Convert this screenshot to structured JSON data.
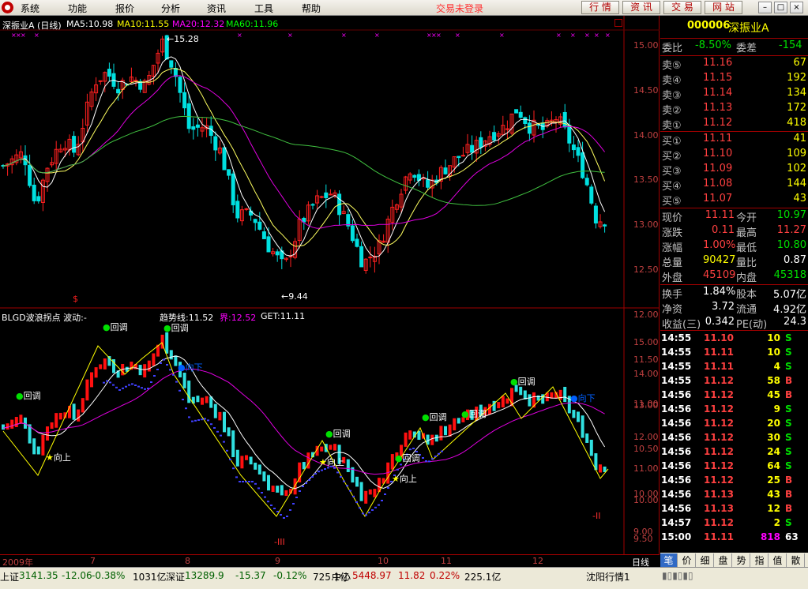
{
  "menu": {
    "items": [
      "系统",
      "功能",
      "报价",
      "分析",
      "资讯",
      "工具",
      "帮助"
    ],
    "status": "交易未登录",
    "buttons": [
      "行 情",
      "资 讯",
      "交 易",
      "网 站"
    ],
    "window_buttons": [
      "–",
      "□",
      "×"
    ]
  },
  "chart": {
    "title": "深振业A (日线)",
    "ma": [
      {
        "label": "MA5:10.98",
        "color": "#ffffff"
      },
      {
        "label": "MA10:11.55",
        "color": "#ffff00"
      },
      {
        "label": "MA20:12.32",
        "color": "#ff00ff"
      },
      {
        "label": "MA60:11.96",
        "color": "#00ff00"
      }
    ],
    "max_label": "15.28",
    "min_label": "9.44",
    "y_ticks_top": [
      "15.00",
      "14.50",
      "14.00",
      "13.50",
      "13.00",
      "12.50",
      "12.00",
      "11.50",
      "11.00",
      "10.50",
      "10.00",
      "9.50"
    ],
    "ind_title": "BLGD波浪拐点  波动:-",
    "ind_values": [
      {
        "label": "趋势线:11.52",
        "color": "#ffffff"
      },
      {
        "label": "界:12.52",
        "color": "#ff00ff"
      },
      {
        "label": "GET:11.11",
        "color": "#ffffff"
      }
    ],
    "y_ticks_bottom": [
      "15.00",
      "14.00",
      "13.00",
      "12.00",
      "11.00",
      "10.00",
      "9.00"
    ],
    "x_labels": [
      "2009年",
      "7",
      "8",
      "9",
      "10",
      "11",
      "12"
    ],
    "period_tab": "日线",
    "annotations": {
      "huitiao": "回调",
      "xiangshang": "向上",
      "xiangxia": "向下",
      "roman2": "-II",
      "roman3": "-III",
      "dollar": "$"
    }
  },
  "quote": {
    "code": "000006",
    "name": "深振业A",
    "webi_label": "委比",
    "webi_value": "-8.50%",
    "weicha_label": "委差",
    "weicha_value": "-154",
    "asks": [
      {
        "label": "卖⑤",
        "price": "11.16",
        "vol": "67"
      },
      {
        "label": "卖④",
        "price": "11.15",
        "vol": "192"
      },
      {
        "label": "卖③",
        "price": "11.14",
        "vol": "134"
      },
      {
        "label": "卖②",
        "price": "11.13",
        "vol": "172"
      },
      {
        "label": "卖①",
        "price": "11.12",
        "vol": "418"
      }
    ],
    "bids": [
      {
        "label": "买①",
        "price": "11.11",
        "vol": "41"
      },
      {
        "label": "买②",
        "price": "11.10",
        "vol": "109"
      },
      {
        "label": "买③",
        "price": "11.09",
        "vol": "102"
      },
      {
        "label": "买④",
        "price": "11.08",
        "vol": "144"
      },
      {
        "label": "买⑤",
        "price": "11.07",
        "vol": "43"
      }
    ],
    "stats": [
      {
        "l1": "现价",
        "v1": "11.11",
        "c1": "#ff4040",
        "l2": "今开",
        "v2": "10.97",
        "c2": "#00e000"
      },
      {
        "l1": "涨跌",
        "v1": "0.11",
        "c1": "#ff4040",
        "l2": "最高",
        "v2": "11.27",
        "c2": "#ff4040"
      },
      {
        "l1": "涨幅",
        "v1": "1.00%",
        "c1": "#ff4040",
        "l2": "最低",
        "v2": "10.80",
        "c2": "#00e000"
      },
      {
        "l1": "总量",
        "v1": "90427",
        "c1": "#ffff00",
        "l2": "量比",
        "v2": "0.87",
        "c2": "#ffffff"
      },
      {
        "l1": "外盘",
        "v1": "45109",
        "c1": "#ff4040",
        "l2": "内盘",
        "v2": "45318",
        "c2": "#00e000"
      }
    ],
    "stats2": [
      {
        "l1": "换手",
        "v1": "1.84%",
        "l2": "股本",
        "v2": "5.07亿"
      },
      {
        "l1": "净资",
        "v1": "3.72",
        "l2": "流通",
        "v2": "4.92亿"
      },
      {
        "l1": "收益(三)",
        "v1": "0.342",
        "l2": "PE(动)",
        "v2": "24.3"
      }
    ],
    "ticks": [
      {
        "t": "14:55",
        "p": "11.10",
        "v": "10",
        "s": "S"
      },
      {
        "t": "14:55",
        "p": "11.11",
        "v": "10",
        "s": "S"
      },
      {
        "t": "14:55",
        "p": "11.11",
        "v": "4",
        "s": "S"
      },
      {
        "t": "14:55",
        "p": "11.12",
        "v": "58",
        "s": "B"
      },
      {
        "t": "14:56",
        "p": "11.12",
        "v": "45",
        "s": "B"
      },
      {
        "t": "14:56",
        "p": "11.12",
        "v": "9",
        "s": "S"
      },
      {
        "t": "14:56",
        "p": "11.12",
        "v": "20",
        "s": "S"
      },
      {
        "t": "14:56",
        "p": "11.12",
        "v": "30",
        "s": "S"
      },
      {
        "t": "14:56",
        "p": "11.12",
        "v": "24",
        "s": "S"
      },
      {
        "t": "14:56",
        "p": "11.12",
        "v": "64",
        "s": "S"
      },
      {
        "t": "14:56",
        "p": "11.12",
        "v": "25",
        "s": "B"
      },
      {
        "t": "14:56",
        "p": "11.13",
        "v": "43",
        "s": "B"
      },
      {
        "t": "14:56",
        "p": "11.13",
        "v": "12",
        "s": "B"
      },
      {
        "t": "14:57",
        "p": "11.12",
        "v": "2",
        "s": "S"
      },
      {
        "t": "15:00",
        "p": "11.11",
        "v": "818",
        "s": "63"
      }
    ],
    "tabs": [
      "笔",
      "价",
      "细",
      "盘",
      "势",
      "指",
      "值",
      "散"
    ]
  },
  "status": {
    "items": [
      {
        "name": "上证",
        "val": "3141.35",
        "chg": "-12.06",
        "pct": "-0.38%",
        "amt": "1031亿"
      },
      {
        "name": "深证",
        "val": "13289.9",
        "chg": "-15.37",
        "pct": "-0.12%",
        "amt": "725.1亿"
      },
      {
        "name": "中小",
        "val": "5448.97",
        "chg": "11.82",
        "pct": "0.22%",
        "amt": "225.1亿"
      }
    ],
    "server": "沈阳行情1"
  },
  "colors": {
    "up": "#ff0000",
    "down": "#00ffff",
    "bg": "#000000",
    "grid": "#800000",
    "axis": "#a00000"
  }
}
